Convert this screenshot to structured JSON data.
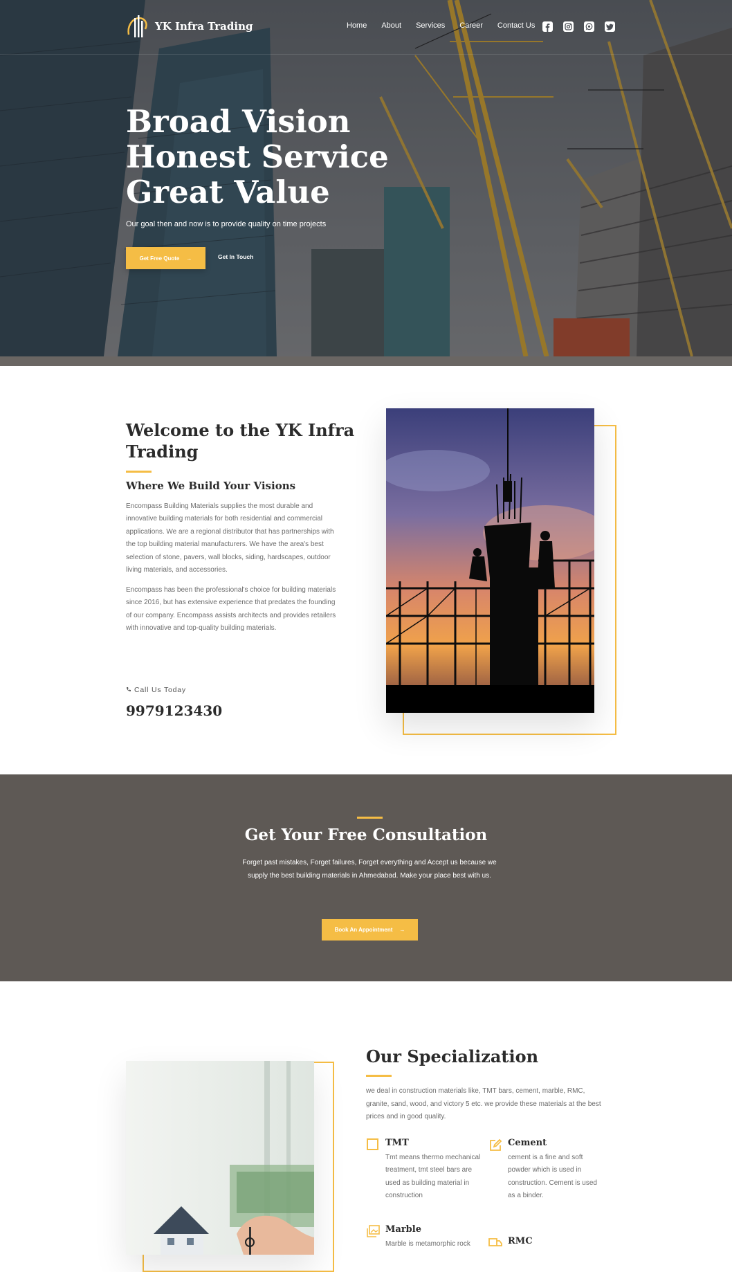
{
  "brand": {
    "name": "YK Infra Trading"
  },
  "nav": {
    "items": [
      "Home",
      "About",
      "Services",
      "Career",
      "Contact Us"
    ],
    "social": [
      "facebook-icon",
      "instagram-icon",
      "whatsapp-icon",
      "twitter-icon"
    ]
  },
  "hero": {
    "title_lines": [
      "Broad Vision",
      "Honest Service",
      "Great Value"
    ],
    "subtitle": "Our goal then and now is to provide quality on time projects",
    "primary_button": "Get Free Quote",
    "secondary_button": "Get In Touch"
  },
  "welcome": {
    "title": "Welcome to the YK Infra Trading",
    "subtitle": "Where We Build Your Visions",
    "paragraph1": "Encompass Building Materials supplies the most durable and innovative building materials for both residential and commercial applications. We are a regional distributor that has partnerships with the top building material manufacturers. We have the area's best selection of stone, pavers, wall blocks, siding, hardscapes, outdoor living materials, and accessories.",
    "paragraph2": "Encompass has been the professional's choice for building materials since 2016, but has extensive experience that predates the founding of our company. Encompass assists architects and provides retailers with innovative and top-quality building materials.",
    "call_label": "Call Us Today",
    "phone": "9979123430"
  },
  "consultation": {
    "title": "Get Your Free Consultation",
    "text": "Forget past mistakes, Forget failures, Forget everything and Accept us because we supply the best building materials in Ahmedabad. Make your place best with us.",
    "button": "Book An Appointment"
  },
  "specialization": {
    "title": "Our Specialization",
    "intro": "we deal in construction materials like, TMT bars, cement, marble, RMC, granite, sand, wood, and victory 5 etc. we provide these materials at the best prices and in good quality.",
    "items": [
      {
        "name": "TMT",
        "text": "Tmt means thermo mechanical treatment, tmt steel bars are used as building material in construction",
        "icon": "square-outline-icon"
      },
      {
        "name": "Cement",
        "text": "cement is a fine and soft powder which is used in construction. Cement is used as a binder.",
        "icon": "edit-icon"
      },
      {
        "name": "Marble",
        "text": "Marble is metamorphic rock",
        "icon": "gallery-icon"
      },
      {
        "name": "RMC",
        "text": "",
        "icon": "truck-icon"
      }
    ]
  },
  "colors": {
    "accent": "#f5bd45",
    "dark_band": "#5e5955",
    "heading": "#2b2b2b",
    "body_text": "#6b6b6b"
  }
}
